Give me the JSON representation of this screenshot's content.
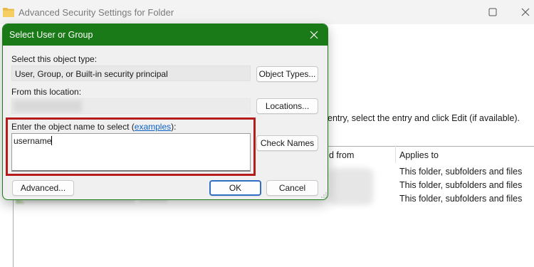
{
  "background_window": {
    "title": "Advanced Security Settings for Folder",
    "info_text": "entry, select the entry and click Edit (if available).",
    "table": {
      "headers": [
        "d from",
        "Applies to"
      ],
      "rows": [
        {
          "applies_to": "This folder, subfolders and files"
        },
        {
          "applies_to": "This folder, subfolders and files"
        },
        {
          "applies_to": "This folder, subfolders and files"
        }
      ]
    }
  },
  "dialog": {
    "title": "Select User or Group",
    "object_type": {
      "label": "Select this object type:",
      "value": "User, Group, or Built-in security principal",
      "button": "Object Types..."
    },
    "location": {
      "label": "From this location:",
      "value": "",
      "button": "Locations..."
    },
    "object_name": {
      "label": "Enter the object name to select (",
      "link": "examples",
      "label_suffix": "):",
      "value": "username"
    },
    "check_names_button": "Check Names",
    "advanced_button": "Advanced...",
    "ok_button": "OK",
    "cancel_button": "Cancel"
  },
  "colors": {
    "dialog_accent": "#1a7a18",
    "highlight": "#b51c1c",
    "link": "#0b61c4",
    "default_button_border": "#2f6fc6"
  },
  "icons": [
    "folder-icon",
    "maximize-icon",
    "close-icon",
    "dialog-close-icon",
    "resize-grip-icon"
  ]
}
